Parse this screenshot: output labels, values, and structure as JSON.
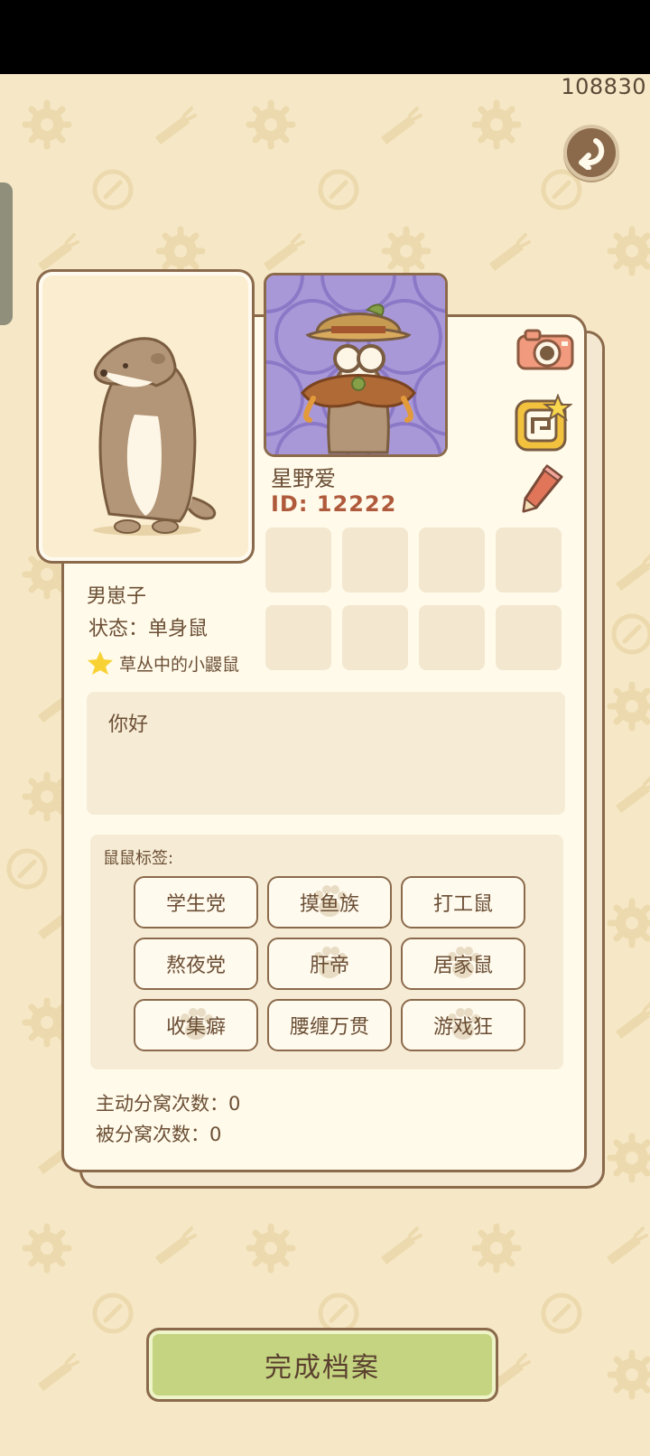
{
  "status_counter": "108830",
  "icons": {
    "back": "back-arrow-icon",
    "camera": "camera-icon",
    "frame": "star-frame-icon",
    "pencil": "pencil-icon",
    "title_star": "star-icon",
    "tag_paw": "paw-print-icon"
  },
  "profile": {
    "nickname": "星野爱",
    "id_label": "ID: 12222",
    "gender": "男崽子",
    "status": "状态：单身鼠",
    "title": "草丛中的小鼹鼠",
    "bio": "你好"
  },
  "tags": {
    "label": "鼠鼠标签:",
    "items": [
      {
        "label": "学生党",
        "paw": false
      },
      {
        "label": "摸鱼族",
        "paw": true
      },
      {
        "label": "打工鼠",
        "paw": false
      },
      {
        "label": "熬夜党",
        "paw": false
      },
      {
        "label": "肝帝",
        "paw": true
      },
      {
        "label": "居家鼠",
        "paw": true
      },
      {
        "label": "收集癖",
        "paw": true
      },
      {
        "label": "腰缠万贯",
        "paw": false
      },
      {
        "label": "游戏狂",
        "paw": true
      }
    ]
  },
  "stats": {
    "active_split": "主动分窝次数：0",
    "passive_split": "被分窝次数：0"
  },
  "finish_button": "完成档案",
  "colors": {
    "background": "#f6e8c6",
    "card": "#fffaea",
    "border": "#8b6a4c",
    "id_text": "#b05a3c",
    "finish_button": "#c4d480",
    "outfit_bg": "#a998d8"
  }
}
